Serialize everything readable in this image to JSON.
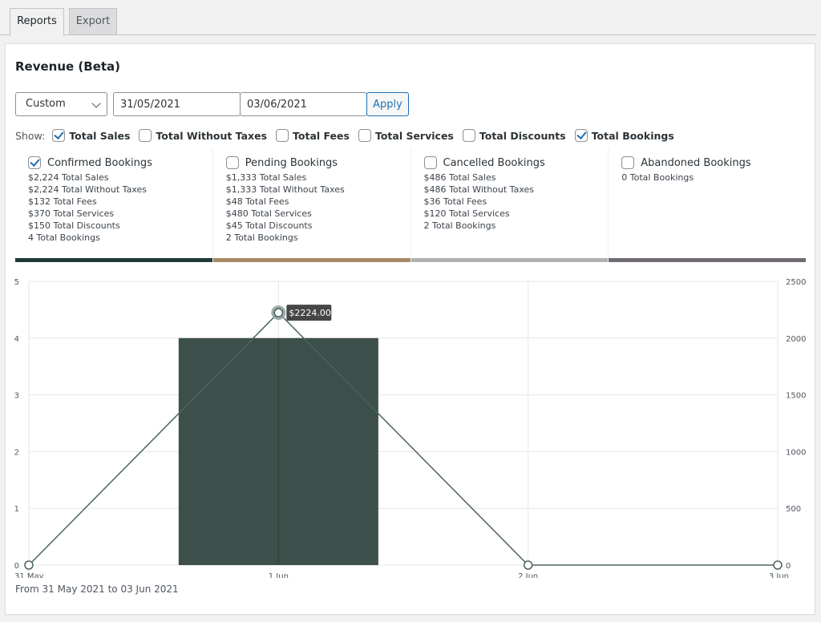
{
  "tabs": [
    {
      "label": "Reports",
      "active": true
    },
    {
      "label": "Export",
      "active": false
    }
  ],
  "panel": {
    "title": "Revenue (Beta)"
  },
  "filters": {
    "range_select": "Custom",
    "date_from": "31/05/2021",
    "date_to": "03/06/2021",
    "apply_label": "Apply"
  },
  "show": {
    "label": "Show:",
    "options": [
      {
        "label": "Total Sales",
        "checked": true
      },
      {
        "label": "Total Without Taxes",
        "checked": false
      },
      {
        "label": "Total Fees",
        "checked": false
      },
      {
        "label": "Total Services",
        "checked": false
      },
      {
        "label": "Total Discounts",
        "checked": false
      },
      {
        "label": "Total Bookings",
        "checked": true
      }
    ]
  },
  "cards": [
    {
      "title": "Confirmed Bookings",
      "checked": true,
      "color": "#1f3b37",
      "metrics": [
        {
          "value": "$2,224",
          "label": "Total Sales"
        },
        {
          "value": "$2,224",
          "label": "Total Without Taxes"
        },
        {
          "value": "$132",
          "label": "Total Fees"
        },
        {
          "value": "$370",
          "label": "Total Services"
        },
        {
          "value": "$150",
          "label": "Total Discounts"
        },
        {
          "value": "4",
          "label": "Total Bookings"
        }
      ]
    },
    {
      "title": "Pending Bookings",
      "checked": false,
      "color": "#a88a66",
      "metrics": [
        {
          "value": "$1,333",
          "label": "Total Sales"
        },
        {
          "value": "$1,333",
          "label": "Total Without Taxes"
        },
        {
          "value": "$48",
          "label": "Total Fees"
        },
        {
          "value": "$480",
          "label": "Total Services"
        },
        {
          "value": "$45",
          "label": "Total Discounts"
        },
        {
          "value": "2",
          "label": "Total Bookings"
        }
      ]
    },
    {
      "title": "Cancelled Bookings",
      "checked": false,
      "color": "#b0b0b0",
      "metrics": [
        {
          "value": "$486",
          "label": "Total Sales"
        },
        {
          "value": "$486",
          "label": "Total Without Taxes"
        },
        {
          "value": "$36",
          "label": "Total Fees"
        },
        {
          "value": "$120",
          "label": "Total Services"
        },
        {
          "value": "2",
          "label": "Total Bookings"
        }
      ]
    },
    {
      "title": "Abandoned Bookings",
      "checked": false,
      "color": "#6f6b70",
      "metrics": [
        {
          "value": "0",
          "label": "Total Bookings"
        }
      ]
    }
  ],
  "chart_data": {
    "type": "bar",
    "categories": [
      "31 May",
      "1 Jun",
      "2 Jun",
      "3 Jun"
    ],
    "series": [
      {
        "name": "Total Bookings",
        "kind": "bar",
        "axis": "left",
        "values": [
          0,
          4,
          0,
          0
        ],
        "color": "#3d4f4a"
      },
      {
        "name": "Total Sales",
        "kind": "line",
        "axis": "right",
        "values": [
          0,
          2224,
          0,
          0
        ],
        "color": "#4b6460"
      }
    ],
    "left_axis": {
      "ylim": [
        0,
        5
      ],
      "ticks": [
        "0",
        "1",
        "2",
        "3",
        "4",
        "5"
      ]
    },
    "right_axis": {
      "ylim": [
        0,
        2500
      ],
      "ticks": [
        "0",
        "500",
        "1000",
        "1500",
        "2000",
        "2500"
      ]
    },
    "tooltip": {
      "category": "1 Jun",
      "text": "$2224.00"
    },
    "grid": true,
    "legend": "none"
  },
  "range_caption": "From 31 May 2021 to 03 Jun 2021"
}
